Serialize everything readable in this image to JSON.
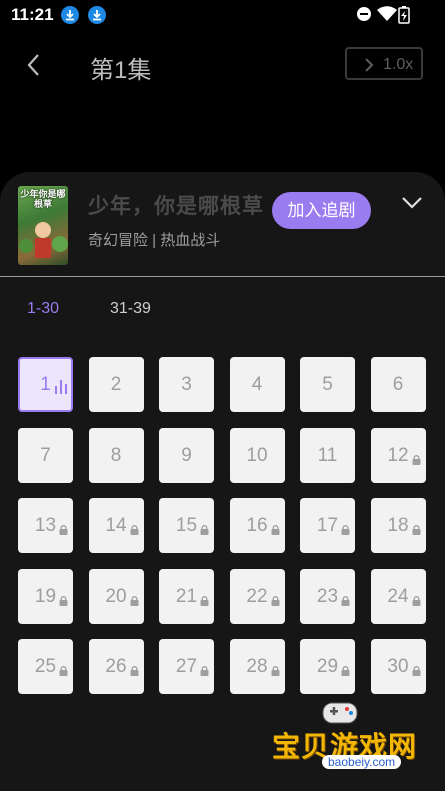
{
  "status_bar": {
    "time": "11:21"
  },
  "header": {
    "title": "第1集",
    "speed": "1.0x"
  },
  "show": {
    "poster_text": "少年你是哪根草",
    "name": "少年，你是哪根草",
    "genre": "奇幻冒险 | 热血战斗",
    "follow_label": "加入追剧"
  },
  "range_tabs": [
    {
      "label": "1-30",
      "active": true
    },
    {
      "label": "31-39",
      "active": false
    }
  ],
  "episodes": [
    {
      "n": "1",
      "current": true,
      "locked": false
    },
    {
      "n": "2",
      "current": false,
      "locked": false
    },
    {
      "n": "3",
      "current": false,
      "locked": false
    },
    {
      "n": "4",
      "current": false,
      "locked": false
    },
    {
      "n": "5",
      "current": false,
      "locked": false
    },
    {
      "n": "6",
      "current": false,
      "locked": false
    },
    {
      "n": "7",
      "current": false,
      "locked": false
    },
    {
      "n": "8",
      "current": false,
      "locked": false
    },
    {
      "n": "9",
      "current": false,
      "locked": false
    },
    {
      "n": "10",
      "current": false,
      "locked": false
    },
    {
      "n": "11",
      "current": false,
      "locked": false
    },
    {
      "n": "12",
      "current": false,
      "locked": true
    },
    {
      "n": "13",
      "current": false,
      "locked": true
    },
    {
      "n": "14",
      "current": false,
      "locked": true
    },
    {
      "n": "15",
      "current": false,
      "locked": true
    },
    {
      "n": "16",
      "current": false,
      "locked": true
    },
    {
      "n": "17",
      "current": false,
      "locked": true
    },
    {
      "n": "18",
      "current": false,
      "locked": true
    },
    {
      "n": "19",
      "current": false,
      "locked": true
    },
    {
      "n": "20",
      "current": false,
      "locked": true
    },
    {
      "n": "21",
      "current": false,
      "locked": true
    },
    {
      "n": "22",
      "current": false,
      "locked": true
    },
    {
      "n": "23",
      "current": false,
      "locked": true
    },
    {
      "n": "24",
      "current": false,
      "locked": true
    },
    {
      "n": "25",
      "current": false,
      "locked": true
    },
    {
      "n": "26",
      "current": false,
      "locked": true
    },
    {
      "n": "27",
      "current": false,
      "locked": true
    },
    {
      "n": "28",
      "current": false,
      "locked": true
    },
    {
      "n": "29",
      "current": false,
      "locked": true
    },
    {
      "n": "30",
      "current": false,
      "locked": true
    }
  ],
  "watermark": {
    "text": "宝贝游戏网",
    "url": "baobeiy.com"
  },
  "colors": {
    "accent": "#9a7bf0",
    "tile": "#f2f2f2",
    "sheet": "#161616",
    "download_badge": "#1e88e5"
  }
}
